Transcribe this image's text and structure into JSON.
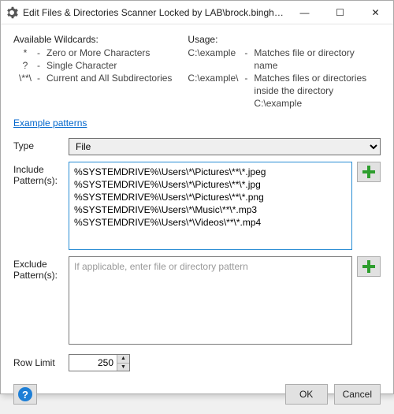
{
  "window": {
    "title": "Edit Files & Directories Scanner Locked by LAB\\brock.bingham on..."
  },
  "wildcards": {
    "heading": "Available Wildcards:",
    "items": [
      {
        "key": "*",
        "desc": "Zero or More Characters"
      },
      {
        "key": "?",
        "desc": "Single Character"
      },
      {
        "key": "\\**\\",
        "desc": "Current and All Subdirectories"
      }
    ]
  },
  "usage": {
    "heading": "Usage:",
    "items": [
      {
        "key": "C:\\example",
        "desc": "Matches file or directory name"
      },
      {
        "key": "C:\\example\\",
        "desc": "Matches files or directories inside the directory C:\\example"
      }
    ]
  },
  "example_link": "Example patterns",
  "form": {
    "type_label": "Type",
    "type_value": "File",
    "include_label": "Include Pattern(s):",
    "include_value": "%SYSTEMDRIVE%\\Users\\*\\Pictures\\**\\*.jpeg\n%SYSTEMDRIVE%\\Users\\*\\Pictures\\**\\*.jpg\n%SYSTEMDRIVE%\\Users\\*\\Pictures\\**\\*.png\n%SYSTEMDRIVE%\\Users\\*\\Music\\**\\*.mp3\n%SYSTEMDRIVE%\\Users\\*\\Videos\\**\\*.mp4",
    "exclude_label": "Exclude Pattern(s):",
    "exclude_placeholder": "If applicable, enter file or directory pattern",
    "exclude_value": "",
    "rowlimit_label": "Row Limit",
    "rowlimit_value": "250"
  },
  "buttons": {
    "ok": "OK",
    "cancel": "Cancel",
    "help": "?"
  }
}
